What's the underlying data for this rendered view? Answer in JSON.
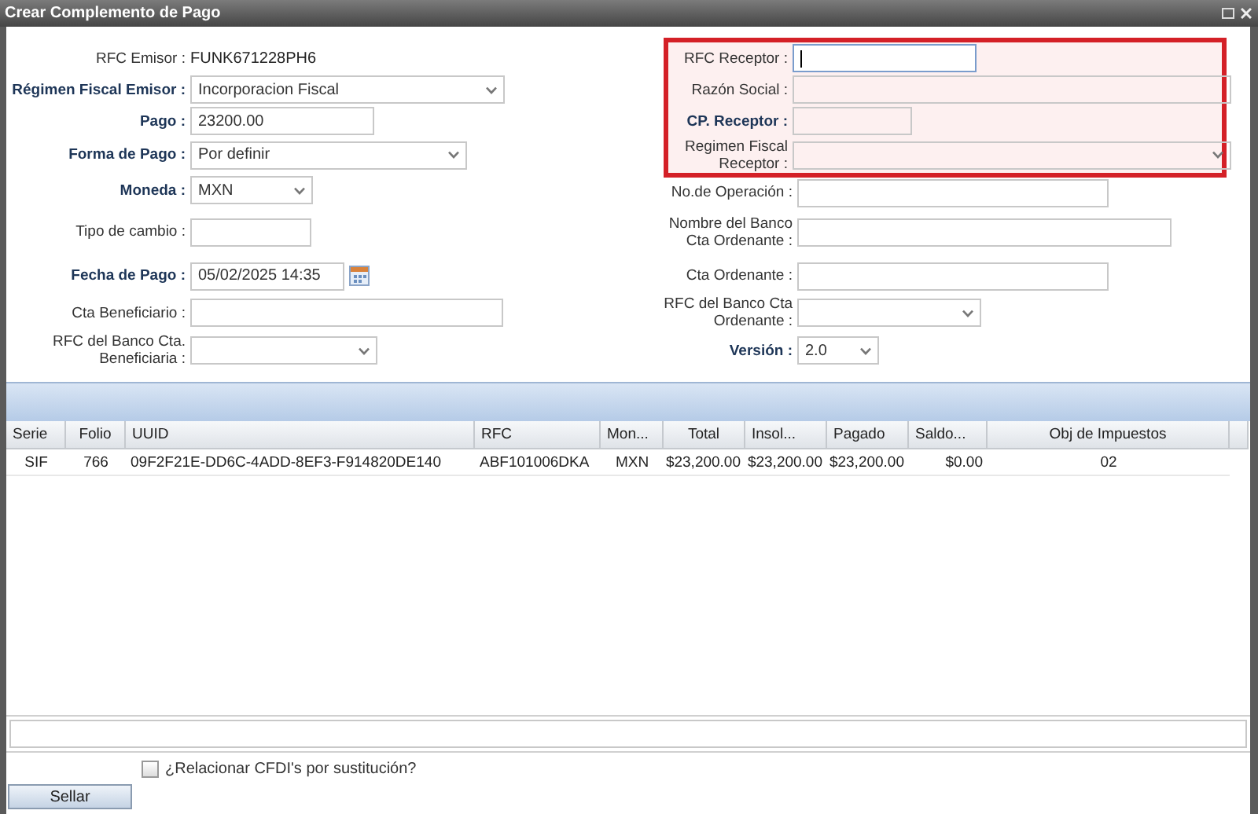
{
  "window": {
    "title": "Crear Complemento de Pago"
  },
  "emisor_fields": [
    {
      "label": "RFC Emisor :",
      "kind": "static",
      "value": "FUNK671228PH6",
      "required": false
    },
    {
      "label": "Régimen Fiscal Emisor :",
      "kind": "select",
      "value": "Incorporacion Fiscal",
      "required": true
    },
    {
      "label": "Pago :",
      "kind": "text",
      "value": "23200.00",
      "required": true
    },
    {
      "label": "Forma de Pago :",
      "kind": "select",
      "value": "Por definir",
      "required": true
    },
    {
      "label": "Moneda :",
      "kind": "select",
      "value": "MXN",
      "required": true
    },
    {
      "label": "Tipo de cambio :",
      "kind": "text",
      "required": false
    },
    {
      "label": "Fecha de Pago :",
      "kind": "date",
      "value": "05/02/2025 14:35",
      "required": true
    },
    {
      "label": "Cta Beneficiario :",
      "kind": "text",
      "required": false
    },
    {
      "label": "RFC del Banco Cta. Beneficiaria :",
      "kind": "select",
      "required": false
    }
  ],
  "receptor_group": {
    "highlighted": true,
    "fields": [
      {
        "label": "RFC Receptor :",
        "kind": "text",
        "required": false,
        "focused": true
      },
      {
        "label": "Razón Social :",
        "kind": "text",
        "required": false,
        "focused": false
      },
      {
        "label": "CP. Receptor :",
        "kind": "text",
        "required": true,
        "focused": false
      },
      {
        "label": "Regimen Fiscal Receptor :",
        "kind": "select",
        "required": false,
        "focused": false
      }
    ]
  },
  "operation_fields": [
    {
      "label": "No.de Operación :",
      "kind": "text",
      "required": false
    },
    {
      "label": "Nombre del Banco Cta Ordenante :",
      "kind": "text",
      "required": false
    },
    {
      "label": "Cta Ordenante :",
      "kind": "text",
      "required": false
    },
    {
      "label": "RFC del Banco Cta Ordenante :",
      "kind": "select",
      "required": false
    },
    {
      "label": "Versión :",
      "kind": "select",
      "value": "2.0",
      "required": true
    }
  ],
  "grid": {
    "columns": [
      "Serie",
      "Folio",
      "UUID",
      "RFC",
      "Mon...",
      "Total",
      "Insol...",
      "Pagado",
      "Saldo...",
      "Obj de Impuestos"
    ],
    "rows": [
      {
        "cells": [
          "SIF",
          "766",
          "09F2F21E-DD6C-4ADD-8EF3-F914820DE140",
          "ABF101006DKA",
          "MXN",
          "$23,200.00",
          "$23,200.00",
          "$23,200.00",
          "$0.00",
          "02"
        ]
      }
    ]
  },
  "relate_cfdi": {
    "label": "¿Relacionar CFDI's por sustitución?",
    "checked": false
  },
  "seal_button": {
    "label": "Sellar"
  }
}
